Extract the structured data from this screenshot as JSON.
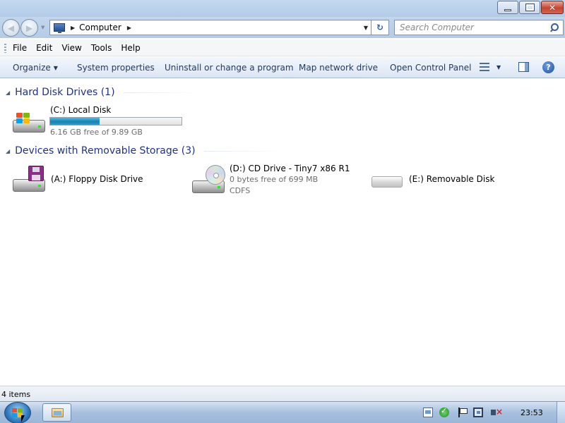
{
  "window": {
    "caption_buttons": [
      "minimize",
      "maximize",
      "close"
    ],
    "close_glyph": "✕"
  },
  "nav": {
    "back_glyph": "◀",
    "forward_glyph": "▶",
    "address_path": "Computer",
    "search_placeholder": "Search Computer",
    "refresh_glyph": "↻"
  },
  "menu": {
    "items": [
      "File",
      "Edit",
      "View",
      "Tools",
      "Help"
    ]
  },
  "commands": {
    "organize": "Organize",
    "system_properties": "System properties",
    "uninstall": "Uninstall or change a program",
    "map_network": "Map network drive",
    "open_control_panel": "Open Control Panel",
    "help_glyph": "?"
  },
  "groups": [
    {
      "title": "Hard Disk Drives (1)",
      "items": [
        {
          "name": "(C:) Local Disk",
          "detail": "6.16 GB free of 9.89 GB",
          "used_fraction": 0.377,
          "icon": "hard-disk-icon"
        }
      ]
    },
    {
      "title": "Devices with Removable Storage (3)",
      "items": [
        {
          "name": "(A:) Floppy Disk Drive",
          "icon": "floppy-drive-icon"
        },
        {
          "name": "(D:) CD Drive - Tiny7 x86 R1",
          "detail": "0 bytes free of 699 MB",
          "detail2": "CDFS",
          "icon": "cd-drive-icon"
        },
        {
          "name": "(E:) Removable Disk",
          "icon": "removable-disk-icon"
        }
      ]
    }
  ],
  "status": {
    "item_count": "4 items"
  },
  "taskbar": {
    "clock": "23:53"
  },
  "colors": {
    "accent_title": "#1e3287",
    "capacity_fill": "#1b7fb2"
  }
}
